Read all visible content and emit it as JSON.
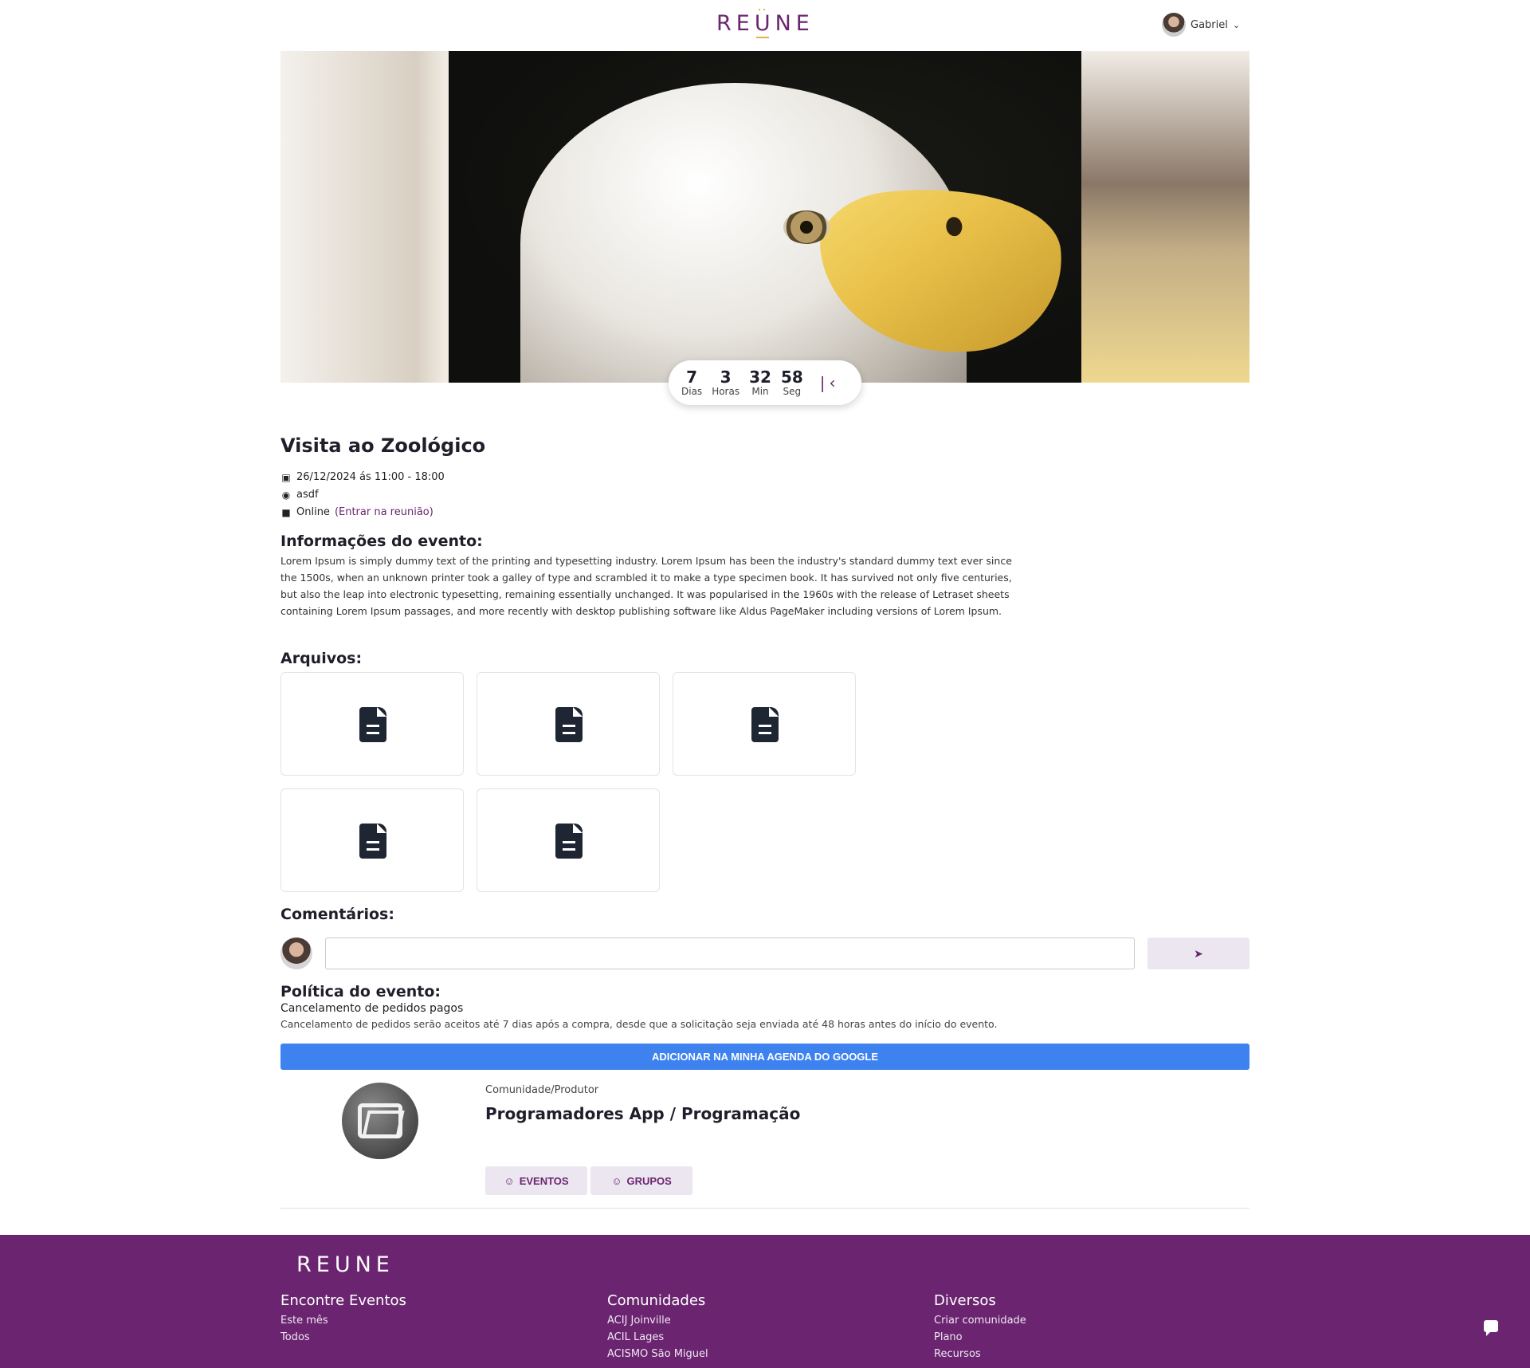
{
  "header": {
    "logo": "REÜNE",
    "user_name": "Gabriel"
  },
  "countdown": [
    {
      "value": "7",
      "label": "Dias"
    },
    {
      "value": "3",
      "label": "Horas"
    },
    {
      "value": "32",
      "label": "Min"
    },
    {
      "value": "58",
      "label": "Seg"
    }
  ],
  "event": {
    "title": "Visita ao Zoológico",
    "datetime": "26/12/2024 ás 11:00 - 18:00",
    "location": "asdf",
    "mode": "Online",
    "join_link": "(Entrar na reunião)"
  },
  "info": {
    "heading": "Informações do evento:",
    "text": "Lorem Ipsum is simply dummy text of the printing and typesetting industry. Lorem Ipsum has been the industry's standard dummy text ever since the 1500s, when an unknown printer took a galley of type and scrambled it to make a type specimen book. It has survived not only five centuries, but also the leap into electronic typesetting, remaining essentially unchanged. It was popularised in the 1960s with the release of Letraset sheets containing Lorem Ipsum passages, and more recently with desktop publishing software like Aldus PageMaker including versions of Lorem Ipsum."
  },
  "files": {
    "heading": "Arquivos:",
    "count": 5,
    "icon": "file-document-icon"
  },
  "comments": {
    "heading": "Comentários:",
    "input_value": "",
    "send_icon": "send-icon"
  },
  "policy": {
    "heading": "Política do evento:",
    "subtitle": "Cancelamento de pedidos pagos",
    "text": "Cancelamento de pedidos serão aceitos até 7 dias após a compra, desde que a solicitação seja enviada até 48 horas antes do início do evento."
  },
  "google_button": "ADICIONAR NA MINHA AGENDA DO GOOGLE",
  "producer": {
    "label": "Comunidade/Produtor",
    "name": "Programadores App / Programação",
    "events_button": "EVENTOS",
    "groups_button": "GRUPOS"
  },
  "footer": {
    "logo": "REÜNE",
    "columns": [
      {
        "title": "Encontre Eventos",
        "links": [
          "Este mês",
          "Todos"
        ]
      },
      {
        "title": "Comunidades",
        "links": [
          "ACIJ Joinville",
          "ACIL Lages",
          "ACISMO São Miguel"
        ]
      },
      {
        "title": "Diversos",
        "links": [
          "Criar comunidade",
          "Plano",
          "Recursos"
        ]
      }
    ]
  },
  "colors": {
    "brand": "#6b2570",
    "google_blue": "#3e82f0",
    "soft_button": "#ece6f0"
  }
}
